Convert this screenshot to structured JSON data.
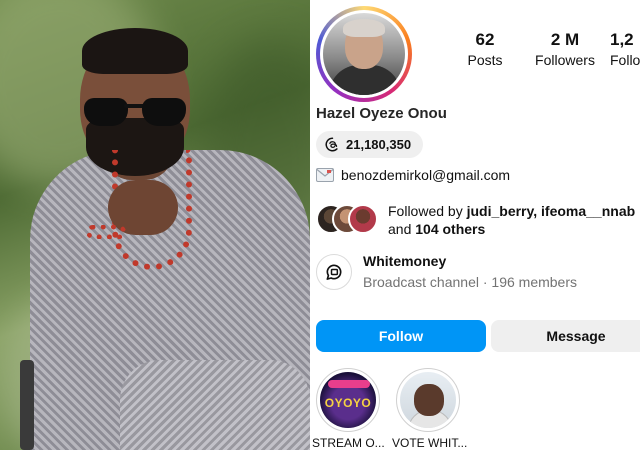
{
  "profile": {
    "name": "Hazel Oyeze Onou",
    "stats": [
      {
        "value": "62",
        "label": "Posts"
      },
      {
        "value": "2 M",
        "label": "Followers"
      },
      {
        "value": "1,2",
        "label": "Follo"
      }
    ],
    "threads_count": "21,180,350",
    "email": "benozdemirkol@gmail.com",
    "followed_by": {
      "prefix": "Followed by",
      "users": "judi_berry, ifeoma__nnab",
      "and": "and",
      "others": "104 others"
    },
    "channel": {
      "title": "Whitemoney",
      "subtitle": "Broadcast channel · 196 members"
    },
    "buttons": {
      "follow": "Follow",
      "message": "Message"
    },
    "highlights": [
      {
        "label": "STREAM O...",
        "art_text": "OYOYO"
      },
      {
        "label": "VOTE WHIT..."
      }
    ]
  },
  "colors": {
    "follow_button": "#0095f6",
    "secondary_button": "#efefef",
    "muted_text": "#737373"
  },
  "icons": [
    "threads-icon",
    "envelope-icon",
    "broadcast-channel-icon"
  ]
}
